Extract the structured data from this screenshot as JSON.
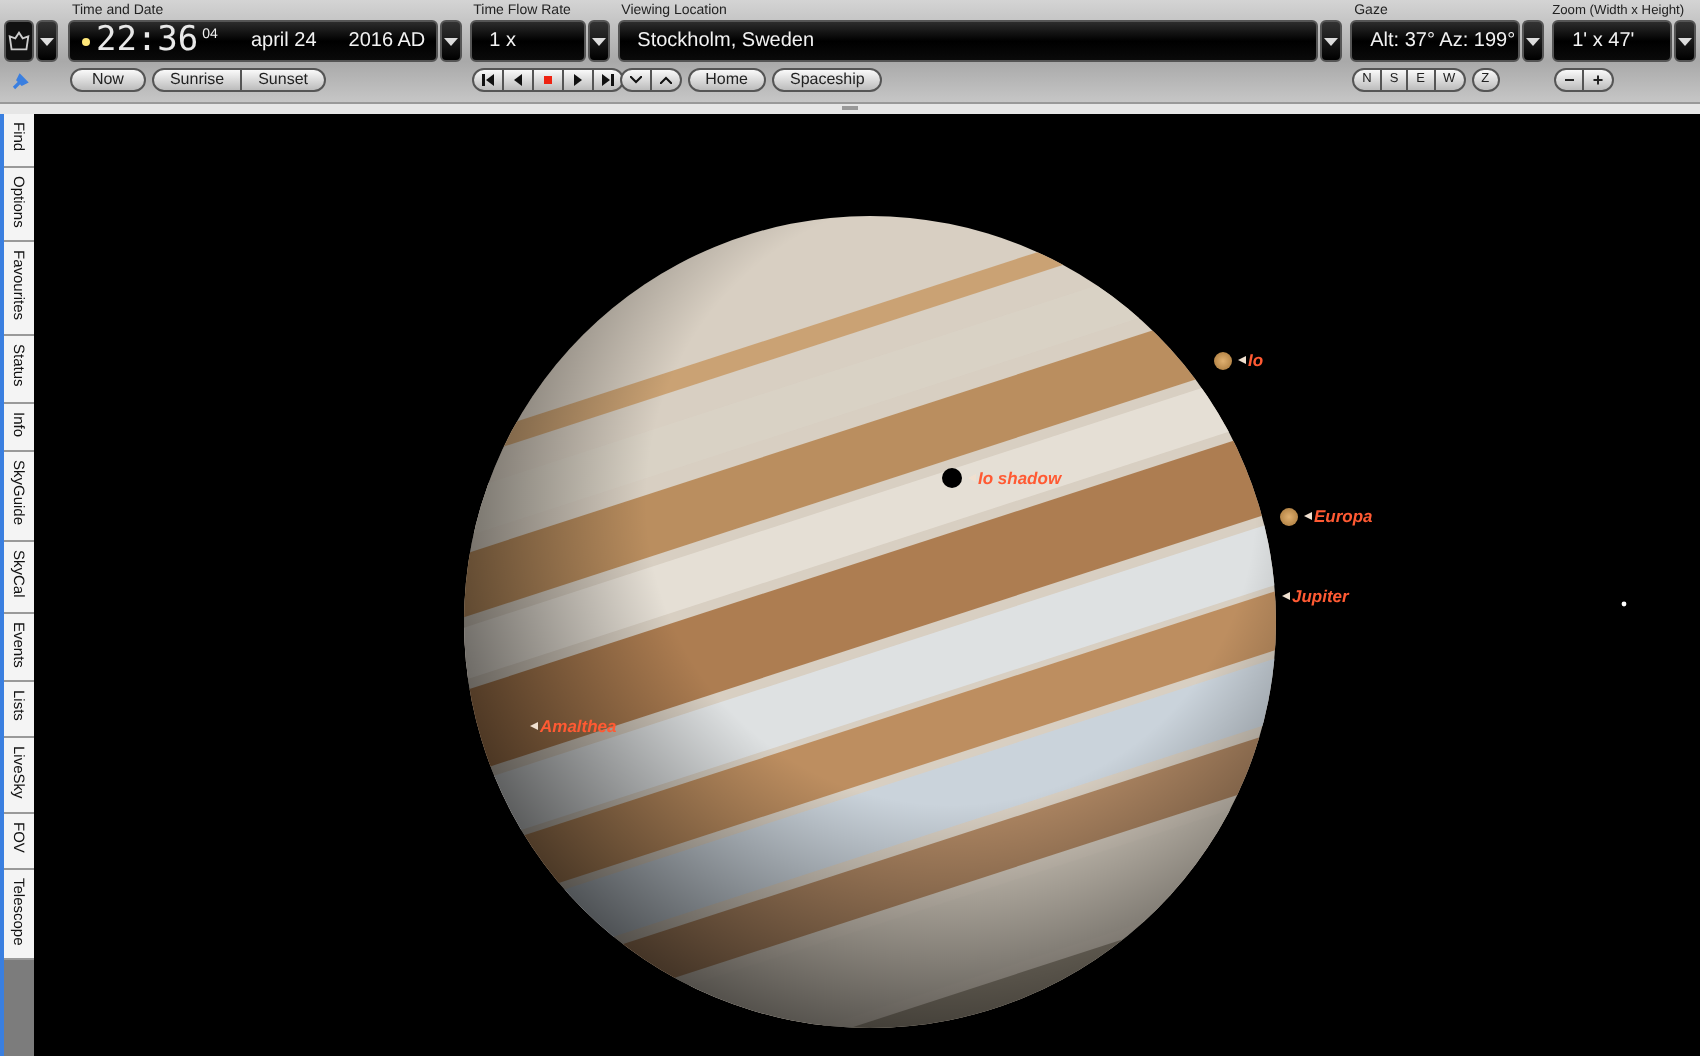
{
  "toolbar": {
    "time_date": {
      "label": "Time and Date",
      "time": "22:36",
      "seconds": "04",
      "date": "april 24",
      "year": "2016 AD",
      "buttons": [
        "Now",
        "Sunrise",
        "Sunset"
      ]
    },
    "time_flow": {
      "label": "Time Flow Rate",
      "value": "1 x"
    },
    "viewing_location": {
      "label": "Viewing Location",
      "value": "Stockholm, Sweden",
      "buttons": [
        "Home",
        "Spaceship"
      ]
    },
    "gaze": {
      "label": "Gaze",
      "value": "Alt: 37° Az: 199°",
      "buttons": [
        "N",
        "S",
        "E",
        "W",
        "Z"
      ]
    },
    "zoom": {
      "label": "Zoom (Width x Height)",
      "value": "1' x 47'",
      "buttons": [
        "−",
        "+"
      ]
    }
  },
  "side_tabs": [
    {
      "label": "Find",
      "selected": false
    },
    {
      "label": "Options",
      "selected": false
    },
    {
      "label": "Favourites",
      "selected": false
    },
    {
      "label": "Status",
      "selected": false
    },
    {
      "label": "Info",
      "selected": false
    },
    {
      "label": "SkyGuide",
      "selected": false
    },
    {
      "label": "SkyCal",
      "selected": false
    },
    {
      "label": "Events",
      "selected": false
    },
    {
      "label": "Lists",
      "selected": false
    },
    {
      "label": "LiveSky",
      "selected": false
    },
    {
      "label": "FOV",
      "selected": false
    },
    {
      "label": "Telescope",
      "selected": false
    }
  ],
  "sky_labels": [
    {
      "name": "Io",
      "kind": "moon"
    },
    {
      "name": "Io shadow",
      "kind": "shadow"
    },
    {
      "name": "Europa",
      "kind": "moon"
    },
    {
      "name": "Jupiter",
      "kind": "planet"
    },
    {
      "name": "Amalthea",
      "kind": "planet"
    }
  ]
}
